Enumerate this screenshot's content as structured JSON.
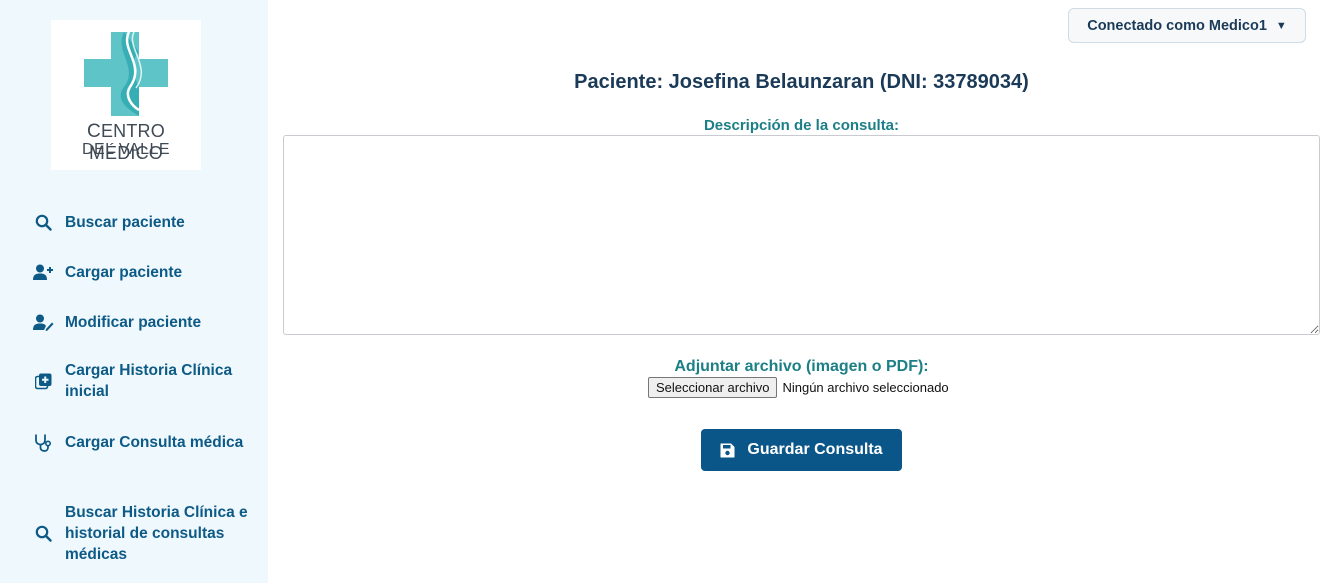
{
  "logo": {
    "line1_prefix_C": "C",
    "line1_rest": "ENTRO ",
    "line1_M": "M",
    "line1_rest2": "ÉDICO",
    "line2": "DEL VALLE",
    "icon": "medical-cross-logo",
    "colors": {
      "cross": "#5ec4c7",
      "cross_dark": "#2aa7ac",
      "text": "#3f4a55"
    }
  },
  "sidebar": {
    "items": [
      {
        "label": "Buscar paciente",
        "icon": "search-icon"
      },
      {
        "label": "Cargar paciente",
        "icon": "user-plus-icon"
      },
      {
        "label": "Modificar paciente",
        "icon": "user-edit-icon"
      },
      {
        "label": "Cargar Historia Clínica inicial",
        "icon": "plus-square-icon"
      },
      {
        "label": "Cargar Consulta médica",
        "icon": "stethoscope-icon"
      },
      {
        "label": "Buscar Historia Clínica e historial de consultas médicas",
        "icon": "search-icon"
      }
    ]
  },
  "header": {
    "user_label": "Conectado como Medico1",
    "caret": "▼"
  },
  "main": {
    "patient_title": "Paciente: Josefina Belaunzaran (DNI: 33789034)",
    "description_label": "Descripción de la consulta:",
    "description_value": "",
    "attach_label": "Adjuntar archivo (imagen o PDF):",
    "file_button": "Seleccionar archivo",
    "file_status": "Ningún archivo seleccionado",
    "save_button": "Guardar Consulta",
    "save_icon": "floppy-disk-icon"
  },
  "colors": {
    "sidebar_bg": "#eef8fd",
    "nav_text": "#0e5a86",
    "title_text": "#1b3a57",
    "label_teal": "#1c7f86",
    "primary_button": "#0b5688"
  }
}
